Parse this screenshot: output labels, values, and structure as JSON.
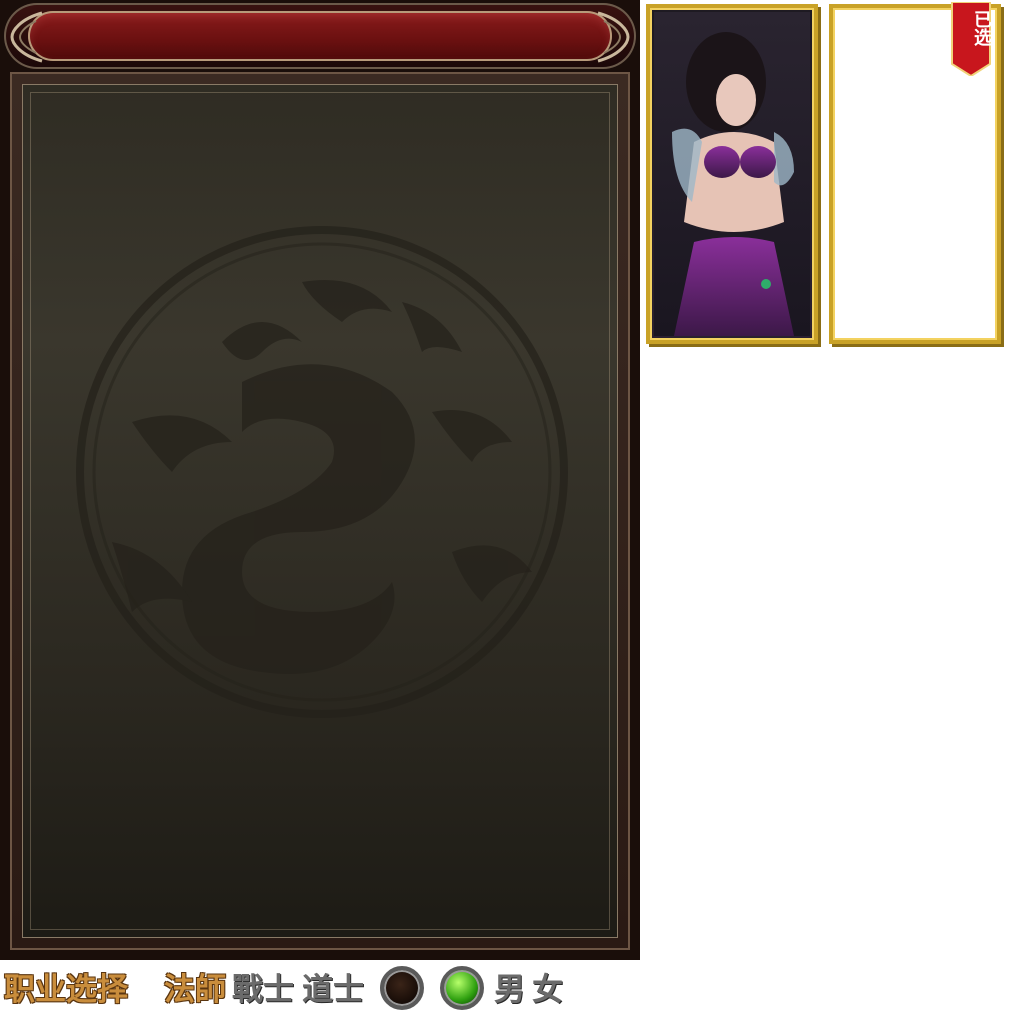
{
  "panel": {
    "banner_title": ""
  },
  "cards": [
    {
      "name": "female-mage-portrait",
      "selected": false
    },
    {
      "name": "empty-slot",
      "selected": true
    }
  ],
  "ribbon": {
    "text": "已选"
  },
  "legend": {
    "title": "职业选择",
    "class_mage": "法師",
    "class_warrior": "戰士",
    "class_taoist": "道士",
    "gender_male": "男",
    "gender_female": "女"
  },
  "colors": {
    "gold_border": "#c9a227",
    "banner_red": "#8b1c1c",
    "ribbon_red": "#c8161d",
    "orb_green": "#2fa010"
  }
}
